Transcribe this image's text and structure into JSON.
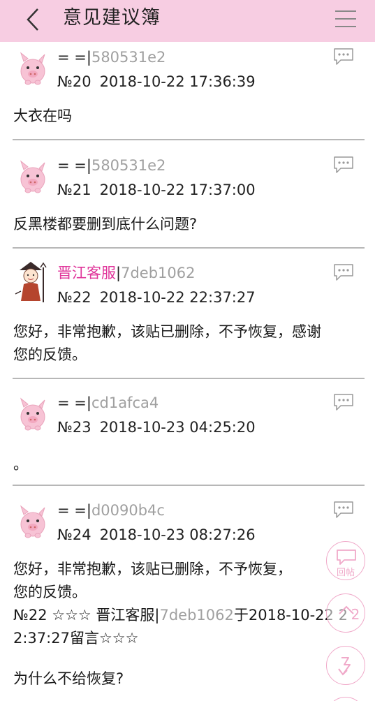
{
  "header": {
    "title": "意见建议簿",
    "back_icon": "chevron-left-icon",
    "menu_icon": "hamburger-menu-icon",
    "bg_color": "#f7cde2"
  },
  "posts": [
    {
      "author": "= =",
      "sep": "|",
      "id": "580531e2",
      "floor": "№20",
      "time": "2018-10-22 17:36:39",
      "body": "大衣在吗",
      "avatar": "pig-avatar"
    },
    {
      "author": "= =",
      "sep": "|",
      "id": "580531e2",
      "floor": "№21",
      "time": "2018-10-22 17:37:00",
      "body": "反黑楼都要删到底什么问题?",
      "avatar": "pig-avatar"
    },
    {
      "author": "晋江客服",
      "sep": "|",
      "id": "7deb1062",
      "floor": "№22",
      "time": "2018-10-22 22:37:27",
      "body_lines": [
        "您好，非常抱歉，该贴已删除，不予恢复，感谢",
        "您的反馈。"
      ],
      "avatar": "staff-avatar",
      "staff": true
    },
    {
      "author": "= =",
      "sep": "|",
      "id": "cd1afca4",
      "floor": "№23",
      "time": "2018-10-23 04:25:20",
      "body": "。",
      "avatar": "pig-avatar"
    },
    {
      "author": "= =",
      "sep": "|",
      "id": "d0090b4c",
      "floor": "№24",
      "time": "2018-10-23 08:27:26",
      "body_lines": [
        "您好，非常抱歉，该贴已删除，不予恢复，",
        "您的反馈。"
      ],
      "quote_prefix": "№22 ☆☆☆ 晋江客服|",
      "quote_id": "7deb1062",
      "quote_suffix": "于2018-10-22 2",
      "quote_line2": "2:37:27留言☆☆☆",
      "reply": "为什么不给恢复?",
      "avatar": "pig-avatar"
    }
  ],
  "fabs": {
    "reply_label": "回帖",
    "up_label": "2"
  },
  "colors": {
    "staff_name": "#e0359a",
    "id_gray": "#a0a0a0",
    "fab_pink": "#f0a9c9",
    "divider": "#b7b7b7"
  }
}
